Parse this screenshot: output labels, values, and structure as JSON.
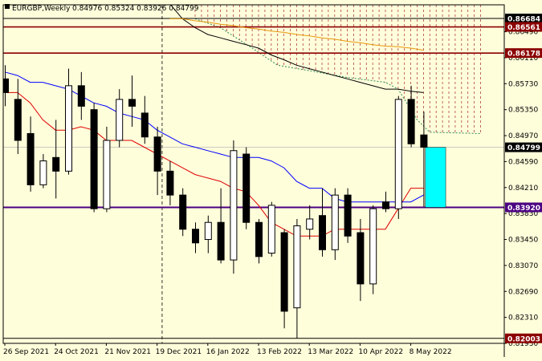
{
  "chart_data": {
    "type": "candlestick",
    "title": "EURGBP,Weekly",
    "ohlc_label": "0.84976 0.85324 0.83926 0.84799",
    "price_range": [
      0.8193,
      0.86884
    ],
    "y_ticks": [
      "0.86490",
      "0.86110",
      "0.85730",
      "0.85350",
      "0.84970",
      "0.84590",
      "0.84210",
      "0.83830",
      "0.83450",
      "0.83070",
      "0.82690",
      "0.82310",
      "0.81930"
    ],
    "x_ticks": [
      {
        "index": 0,
        "label": "26 Sep 2021"
      },
      {
        "index": 4,
        "label": "24 Oct 2021"
      },
      {
        "index": 8,
        "label": "21 Nov 2021"
      },
      {
        "index": 12,
        "label": "19 Dec 2021"
      },
      {
        "index": 16,
        "label": "16 Jan 2022"
      },
      {
        "index": 20,
        "label": "13 Feb 2022"
      },
      {
        "index": 24,
        "label": "13 Mar 2022"
      },
      {
        "index": 28,
        "label": "10 Apr 2022"
      },
      {
        "index": 32,
        "label": "8 May 2022"
      }
    ],
    "candles": [
      {
        "o": 0.858,
        "h": 0.86,
        "l": 0.854,
        "c": 0.856
      },
      {
        "o": 0.855,
        "h": 0.858,
        "l": 0.847,
        "c": 0.849
      },
      {
        "o": 0.85,
        "h": 0.8525,
        "l": 0.8415,
        "c": 0.8425
      },
      {
        "o": 0.8425,
        "h": 0.847,
        "l": 0.842,
        "c": 0.846
      },
      {
        "o": 0.8465,
        "h": 0.852,
        "l": 0.8405,
        "c": 0.8445
      },
      {
        "o": 0.8445,
        "h": 0.8595,
        "l": 0.844,
        "c": 0.857
      },
      {
        "o": 0.857,
        "h": 0.859,
        "l": 0.852,
        "c": 0.854
      },
      {
        "o": 0.8535,
        "h": 0.8545,
        "l": 0.8385,
        "c": 0.839
      },
      {
        "o": 0.839,
        "h": 0.851,
        "l": 0.8385,
        "c": 0.849
      },
      {
        "o": 0.849,
        "h": 0.8565,
        "l": 0.848,
        "c": 0.855
      },
      {
        "o": 0.855,
        "h": 0.8585,
        "l": 0.851,
        "c": 0.854
      },
      {
        "o": 0.853,
        "h": 0.8555,
        "l": 0.8485,
        "c": 0.8495
      },
      {
        "o": 0.8495,
        "h": 0.851,
        "l": 0.841,
        "c": 0.8445
      },
      {
        "o": 0.8445,
        "h": 0.846,
        "l": 0.8395,
        "c": 0.841
      },
      {
        "o": 0.841,
        "h": 0.842,
        "l": 0.835,
        "c": 0.836
      },
      {
        "o": 0.836,
        "h": 0.837,
        "l": 0.8325,
        "c": 0.834
      },
      {
        "o": 0.8345,
        "h": 0.838,
        "l": 0.8325,
        "c": 0.837
      },
      {
        "o": 0.837,
        "h": 0.842,
        "l": 0.831,
        "c": 0.8315
      },
      {
        "o": 0.8315,
        "h": 0.849,
        "l": 0.8295,
        "c": 0.8475
      },
      {
        "o": 0.847,
        "h": 0.848,
        "l": 0.836,
        "c": 0.837
      },
      {
        "o": 0.837,
        "h": 0.8375,
        "l": 0.831,
        "c": 0.832
      },
      {
        "o": 0.8325,
        "h": 0.84,
        "l": 0.832,
        "c": 0.8395
      },
      {
        "o": 0.8355,
        "h": 0.836,
        "l": 0.8215,
        "c": 0.824
      },
      {
        "o": 0.8245,
        "h": 0.8375,
        "l": 0.82,
        "c": 0.8365
      },
      {
        "o": 0.836,
        "h": 0.8395,
        "l": 0.8345,
        "c": 0.8375
      },
      {
        "o": 0.838,
        "h": 0.842,
        "l": 0.832,
        "c": 0.833
      },
      {
        "o": 0.833,
        "h": 0.842,
        "l": 0.8315,
        "c": 0.841
      },
      {
        "o": 0.841,
        "h": 0.842,
        "l": 0.834,
        "c": 0.835
      },
      {
        "o": 0.8355,
        "h": 0.8375,
        "l": 0.8255,
        "c": 0.828
      },
      {
        "o": 0.828,
        "h": 0.8395,
        "l": 0.8265,
        "c": 0.839
      },
      {
        "o": 0.84,
        "h": 0.8415,
        "l": 0.8385,
        "c": 0.839
      },
      {
        "o": 0.839,
        "h": 0.8555,
        "l": 0.8375,
        "c": 0.855
      },
      {
        "o": 0.855,
        "h": 0.857,
        "l": 0.848,
        "c": 0.8485
      },
      {
        "o": 0.8498,
        "h": 0.8532,
        "l": 0.8393,
        "c": 0.848
      }
    ],
    "moving_averages": [
      {
        "color": "#dd0000",
        "values": [
          0.856,
          0.856,
          0.8545,
          0.852,
          0.8505,
          0.8505,
          0.851,
          0.8505,
          0.849,
          0.849,
          0.849,
          0.848,
          0.847,
          0.846,
          0.845,
          0.844,
          0.8435,
          0.843,
          0.842,
          0.8415,
          0.8395,
          0.837,
          0.836,
          0.835,
          0.835,
          0.835,
          0.836,
          0.836,
          0.836,
          0.836,
          0.836,
          0.839,
          0.842,
          0.842
        ]
      },
      {
        "color": "#0000ff",
        "values": [
          0.859,
          0.8585,
          0.8575,
          0.8575,
          0.857,
          0.8565,
          0.8555,
          0.8545,
          0.854,
          0.853,
          0.8525,
          0.852,
          0.8505,
          0.8495,
          0.8485,
          0.848,
          0.8475,
          0.847,
          0.8465,
          0.8465,
          0.8465,
          0.846,
          0.845,
          0.843,
          0.842,
          0.842,
          0.8405,
          0.84,
          0.84,
          0.84,
          0.84,
          0.84,
          0.84,
          0.841
        ]
      },
      {
        "color": "#000000",
        "values": [
          0.869,
          0.869,
          0.869,
          0.869,
          0.869,
          0.869,
          0.869,
          0.869,
          0.869,
          0.869,
          0.869,
          0.869,
          0.869,
          0.869,
          0.8668,
          0.8655,
          0.8645,
          0.864,
          0.8635,
          0.863,
          0.8625,
          0.8615,
          0.8608,
          0.86,
          0.8595,
          0.859,
          0.8585,
          0.858,
          0.8575,
          0.857,
          0.8565,
          0.8565,
          0.8562,
          0.856
        ]
      },
      {
        "color": "#e8960c",
        "values": [
          null,
          null,
          null,
          null,
          null,
          null,
          null,
          null,
          null,
          null,
          null,
          null,
          null,
          0.8668,
          0.8668,
          0.8665,
          0.8663,
          0.866,
          0.8658,
          0.8655,
          0.8653,
          0.865,
          0.8648,
          0.8645,
          0.8643,
          0.864,
          0.8638,
          0.8635,
          0.8633,
          0.863,
          0.8628,
          0.8627,
          0.8625,
          0.8622
        ]
      }
    ],
    "green_cloud_edge": [
      {
        "x": 15.0,
        "y": 0.8668
      },
      {
        "x": 17.0,
        "y": 0.8655
      },
      {
        "x": 19.5,
        "y": 0.8625
      },
      {
        "x": 21.5,
        "y": 0.86
      },
      {
        "x": 24.0,
        "y": 0.8592
      },
      {
        "x": 27.0,
        "y": 0.8582
      },
      {
        "x": 30.0,
        "y": 0.8575
      },
      {
        "x": 31.0,
        "y": 0.8565
      },
      {
        "x": 32.5,
        "y": 0.852
      },
      {
        "x": 33.5,
        "y": 0.8502
      },
      {
        "x": 37.5,
        "y": 0.85
      }
    ],
    "hline_black": [
      0.86684,
      0.82003
    ],
    "hline_red": [
      0.86561,
      0.86178
    ],
    "hline_purple": [
      0.8392
    ],
    "hline_grey": [
      0.84799
    ],
    "badge_labels": [
      {
        "text": "0.86684",
        "y": 0.86684,
        "color": "#000000"
      },
      {
        "text": "0.86561",
        "y": 0.86561,
        "color": "#8b0000"
      },
      {
        "text": "0.86178",
        "y": 0.86178,
        "color": "#8b0000"
      },
      {
        "text": "0.84799",
        "y": 0.84799,
        "color": "#000000"
      },
      {
        "text": "0.83920",
        "y": 0.8392,
        "color": "#4b0082"
      },
      {
        "text": "0.82003",
        "y": 0.82003,
        "color": "#8b0000"
      }
    ],
    "highlight_box": {
      "x0": 33.15,
      "x1": 34.75,
      "y0": 0.8392,
      "y1": 0.84799,
      "color": "#00ffff"
    },
    "vline_dashed_index": 12.4,
    "colors": {
      "background": "#fffedb",
      "bull": "#ffffff",
      "bear": "#000000",
      "red_line": "#8b0000",
      "purple_line": "#4b0082"
    }
  }
}
